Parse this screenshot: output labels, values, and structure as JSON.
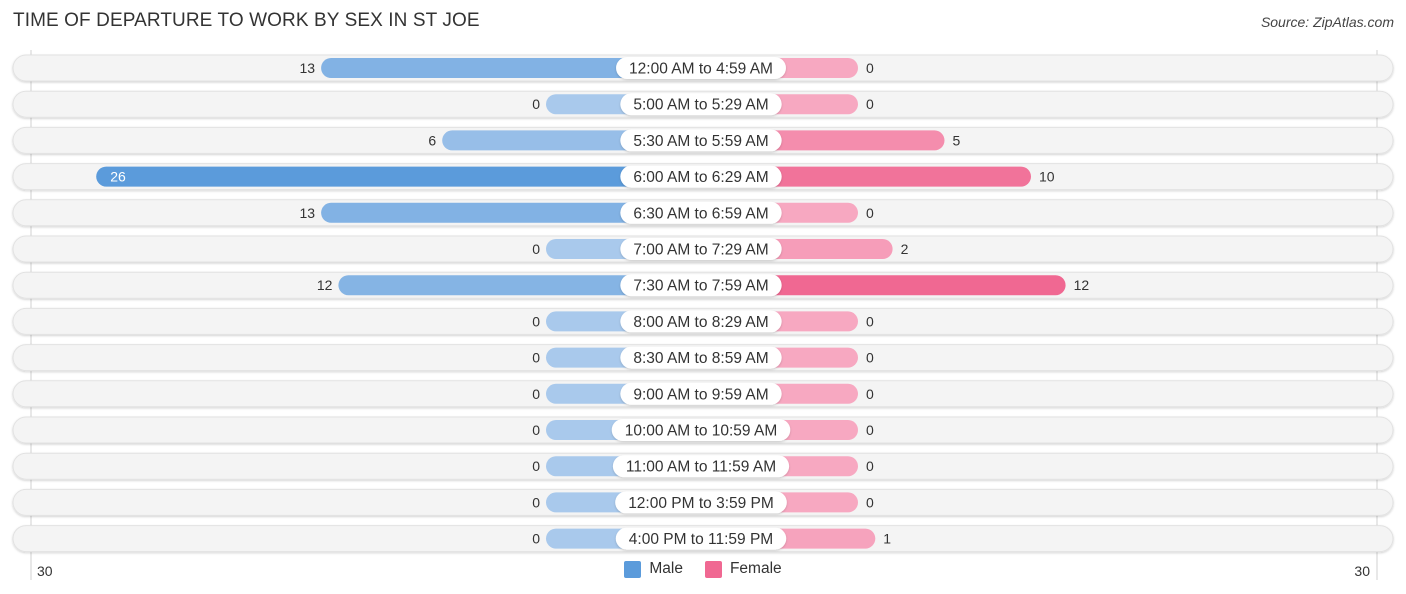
{
  "header": {
    "title": "TIME OF DEPARTURE TO WORK BY SEX IN ST JOE",
    "source": "Source: ZipAtlas.com"
  },
  "legend": {
    "male_label": "Male",
    "female_label": "Female"
  },
  "colors": {
    "male_strong": "#5b9bdb",
    "male_light": "#a9c9ec",
    "female_strong": "#f06892",
    "female_light": "#f7a8c1",
    "row_bg": "#f3f3f3"
  },
  "axis": {
    "left_label": "30",
    "right_label": "30"
  },
  "chart_data": {
    "type": "bar",
    "orientation": "horizontal-diverging",
    "title": "TIME OF DEPARTURE TO WORK BY SEX IN ST JOE",
    "xlabel": "",
    "ylabel": "",
    "xlim": [
      -30,
      30
    ],
    "legend_position": "bottom-center",
    "categories": [
      "12:00 AM to 4:59 AM",
      "5:00 AM to 5:29 AM",
      "5:30 AM to 5:59 AM",
      "6:00 AM to 6:29 AM",
      "6:30 AM to 6:59 AM",
      "7:00 AM to 7:29 AM",
      "7:30 AM to 7:59 AM",
      "8:00 AM to 8:29 AM",
      "8:30 AM to 8:59 AM",
      "9:00 AM to 9:59 AM",
      "10:00 AM to 10:59 AM",
      "11:00 AM to 11:59 AM",
      "12:00 PM to 3:59 PM",
      "4:00 PM to 11:59 PM"
    ],
    "series": [
      {
        "name": "Male",
        "values": [
          13,
          0,
          6,
          26,
          13,
          0,
          12,
          0,
          0,
          0,
          0,
          0,
          0,
          0
        ]
      },
      {
        "name": "Female",
        "values": [
          0,
          0,
          5,
          10,
          0,
          2,
          12,
          0,
          0,
          0,
          0,
          0,
          0,
          1
        ]
      }
    ],
    "tick_labels": [
      "30",
      "30"
    ]
  }
}
